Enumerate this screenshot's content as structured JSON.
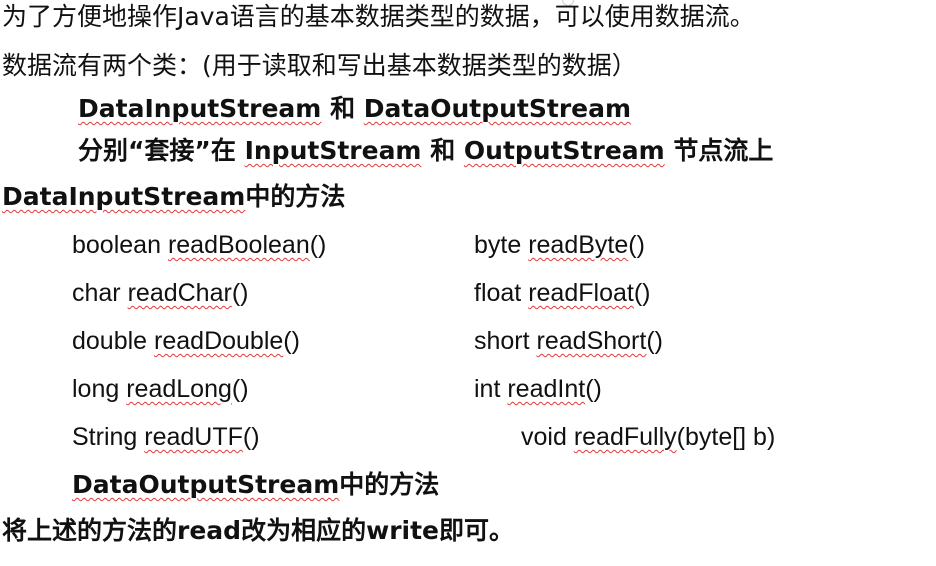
{
  "para1": {
    "line1": "为了方便地操作Java语言的基本数据类型的数据，可以使用数据流。",
    "line2": "数据流有两个类：(用于读取和写出基本数据类型的数据）"
  },
  "classes": {
    "dis": "DataInputStream",
    "he1": " 和 ",
    "dos": "DataOutputStream"
  },
  "socket_line": {
    "prefix": "分别“套接”在 ",
    "input": "InputStream",
    "he2": " 和 ",
    "output": "OutputStream",
    "suffix": " 节点流上"
  },
  "dis_heading": {
    "cls": "DataInputStream",
    "suffix": "中的方法"
  },
  "methods_left": [
    {
      "type": "boolean ",
      "name": "readBoolean",
      "args": "()"
    },
    {
      "type": "char ",
      "name": "readChar",
      "args": "()"
    },
    {
      "type": "double ",
      "name": "readDouble",
      "args": "()"
    },
    {
      "type": "long ",
      "name": "readLong",
      "args": "()"
    },
    {
      "type": "String ",
      "name": "readUTF",
      "args": "()"
    }
  ],
  "methods_right": [
    {
      "type": "byte ",
      "name": "readByte",
      "args": "()"
    },
    {
      "type": "float ",
      "name": "readFloat",
      "args": "()"
    },
    {
      "type": "short ",
      "name": "readShort",
      "args": "()"
    },
    {
      "type": "int ",
      "name": "readInt",
      "args": "()"
    },
    {
      "type": "void ",
      "name": "readFully",
      "args": "(byte[] b)"
    }
  ],
  "dos_heading": {
    "cls": "DataOutputStream",
    "suffix": "中的方法"
  },
  "closing": {
    "prefix": "将上述的方法的",
    "read": "read",
    "mid": "改为相应的",
    "write": "write",
    "suffix": "即可。"
  }
}
